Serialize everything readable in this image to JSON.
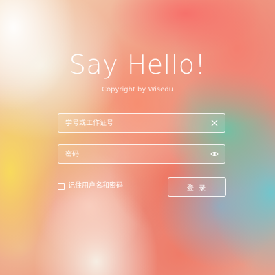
{
  "header": {
    "title": "Say Hello!",
    "copyright": "Copyright by Wisedu"
  },
  "form": {
    "username": {
      "placeholder": "学号或工作证号",
      "value": "",
      "action_icon": "clear-x-icon"
    },
    "password": {
      "placeholder": "密码",
      "value": "",
      "action_icon": "eye-icon"
    },
    "remember": {
      "label": "记住用户名和密码",
      "checked": false
    },
    "login_label": "登 录"
  },
  "colors": {
    "text": "#ffffff",
    "field_border": "#ffffff"
  }
}
